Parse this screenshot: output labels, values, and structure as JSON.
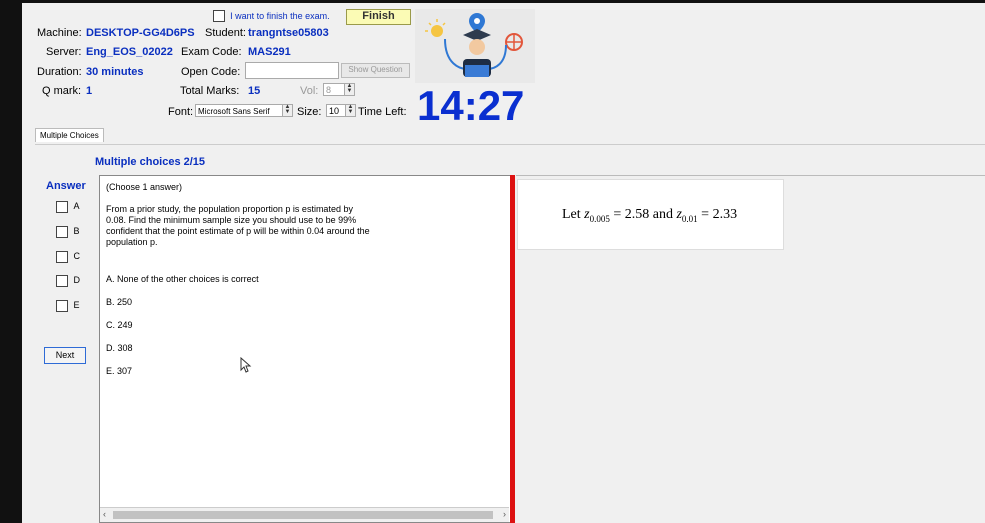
{
  "header": {
    "finish_check_label": "I want to finish the exam.",
    "finish_button": "Finish",
    "machine_label": "Machine:",
    "machine_value": "DESKTOP-GG4D6PS",
    "student_label": "Student:",
    "student_value": "trangntse05803",
    "server_label": "Server:",
    "server_value": "Eng_EOS_02022",
    "exam_code_label": "Exam Code:",
    "exam_code_value": "MAS291",
    "duration_label": "Duration:",
    "duration_value": "30 minutes",
    "open_code_label": "Open Code:",
    "open_code_value": "",
    "show_question_button": "Show Question",
    "qmark_label": "Q mark:",
    "qmark_value": "1",
    "total_marks_label": "Total Marks:",
    "total_marks_value": "15",
    "vol_label": "Vol:",
    "vol_value": "8",
    "font_label": "Font:",
    "font_value": "Microsoft Sans Serif",
    "size_label": "Size:",
    "size_value": "10",
    "time_left_label": "Time Left:",
    "timer": "14:27"
  },
  "tabs": [
    "Multiple Choices"
  ],
  "question": {
    "heading": "Multiple choices 2/15",
    "answer_label": "Answer",
    "answer_options": [
      "A",
      "B",
      "C",
      "D",
      "E"
    ],
    "next_button": "Next",
    "instruction": "(Choose 1 answer)",
    "text_lines": [
      "From a prior study, the population proportion p is estimated by",
      "0.08. Find the minimum sample size you should use to be 99%",
      "confident that the point estimate of p will be within 0.04 around the",
      "population p."
    ],
    "choices": [
      "A.  None of the other choices is correct",
      "B.  250",
      "C.  249",
      "D.  308",
      "E.  307"
    ]
  },
  "formula": {
    "let": "Let",
    "z1_sub": "0.005",
    "eq1": "= 2.58 and",
    "z2_sub": "0.01",
    "eq2": "= 2.33"
  },
  "colors": {
    "accent": "#0a2fbf",
    "divider": "#d11111",
    "finish_bg": "#fbfbb5"
  }
}
